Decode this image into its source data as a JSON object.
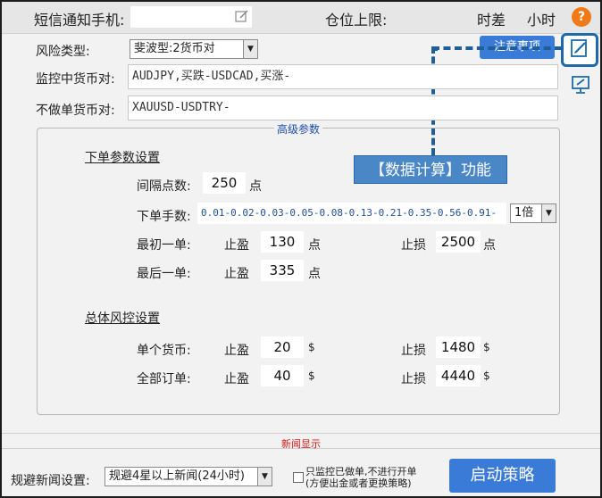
{
  "header": {
    "sms_label": "短信通知手机:",
    "sms_value": "",
    "position_limit_label": "仓位上限:",
    "timezone_label": "时差",
    "hours_label": "小时",
    "help_glyph": "?"
  },
  "risk": {
    "label": "风险类型:",
    "value": "斐波型:2货币对",
    "notice_button": "注意事项"
  },
  "monitor_pairs": {
    "label": "监控中货币对:",
    "value": "AUDJPY,买跌-USDCAD,买涨-"
  },
  "excluded_pairs": {
    "label": "不做单货币对:",
    "value": "XAUUSD-USDTRY-"
  },
  "advanced": {
    "title": "高级参数",
    "order_section": "下单参数设置",
    "interval_label": "间隔点数:",
    "interval_value": "250",
    "interval_unit": "点",
    "lots_label": "下单手数:",
    "lots_value": "0.01-0.02-0.03-0.05-0.08-0.13-0.21-0.35-0.56-0.91-",
    "multiplier": "1倍",
    "first_order_label": "最初一单:",
    "first_tp_label": "止盈",
    "first_tp_value": "130",
    "first_tp_unit": "点",
    "first_sl_label": "止损",
    "first_sl_value": "2500",
    "first_sl_unit": "点",
    "last_order_label": "最后一单:",
    "last_tp_label": "止盈",
    "last_tp_value": "335",
    "last_tp_unit": "点",
    "risk_section": "总体风控设置",
    "single_label": "单个货币:",
    "single_tp_label": "止盈",
    "single_tp_value": "20",
    "single_tp_unit": "$",
    "single_sl_label": "止损",
    "single_sl_value": "1480",
    "single_sl_unit": "$",
    "all_label": "全部订单:",
    "all_tp_label": "止盈",
    "all_tp_value": "40",
    "all_tp_unit": "$",
    "all_sl_label": "止损",
    "all_sl_value": "4440",
    "all_sl_unit": "$"
  },
  "callout": {
    "text": "【数据计算】功能"
  },
  "news": {
    "divider_label": "新闻显示",
    "avoid_label": "规避新闻设置:",
    "avoid_value": "规避4星以上新闻(24小时)",
    "only_monitor_line1": "只监控已做单,不进行开单",
    "only_monitor_line2": "(方便出金或者更换策略)",
    "start_button": "启动策略"
  },
  "colors": {
    "accent": "#3b7bd8",
    "callout": "#4a87c6",
    "news_red": "#d21818",
    "help_orange": "#f07a17"
  }
}
